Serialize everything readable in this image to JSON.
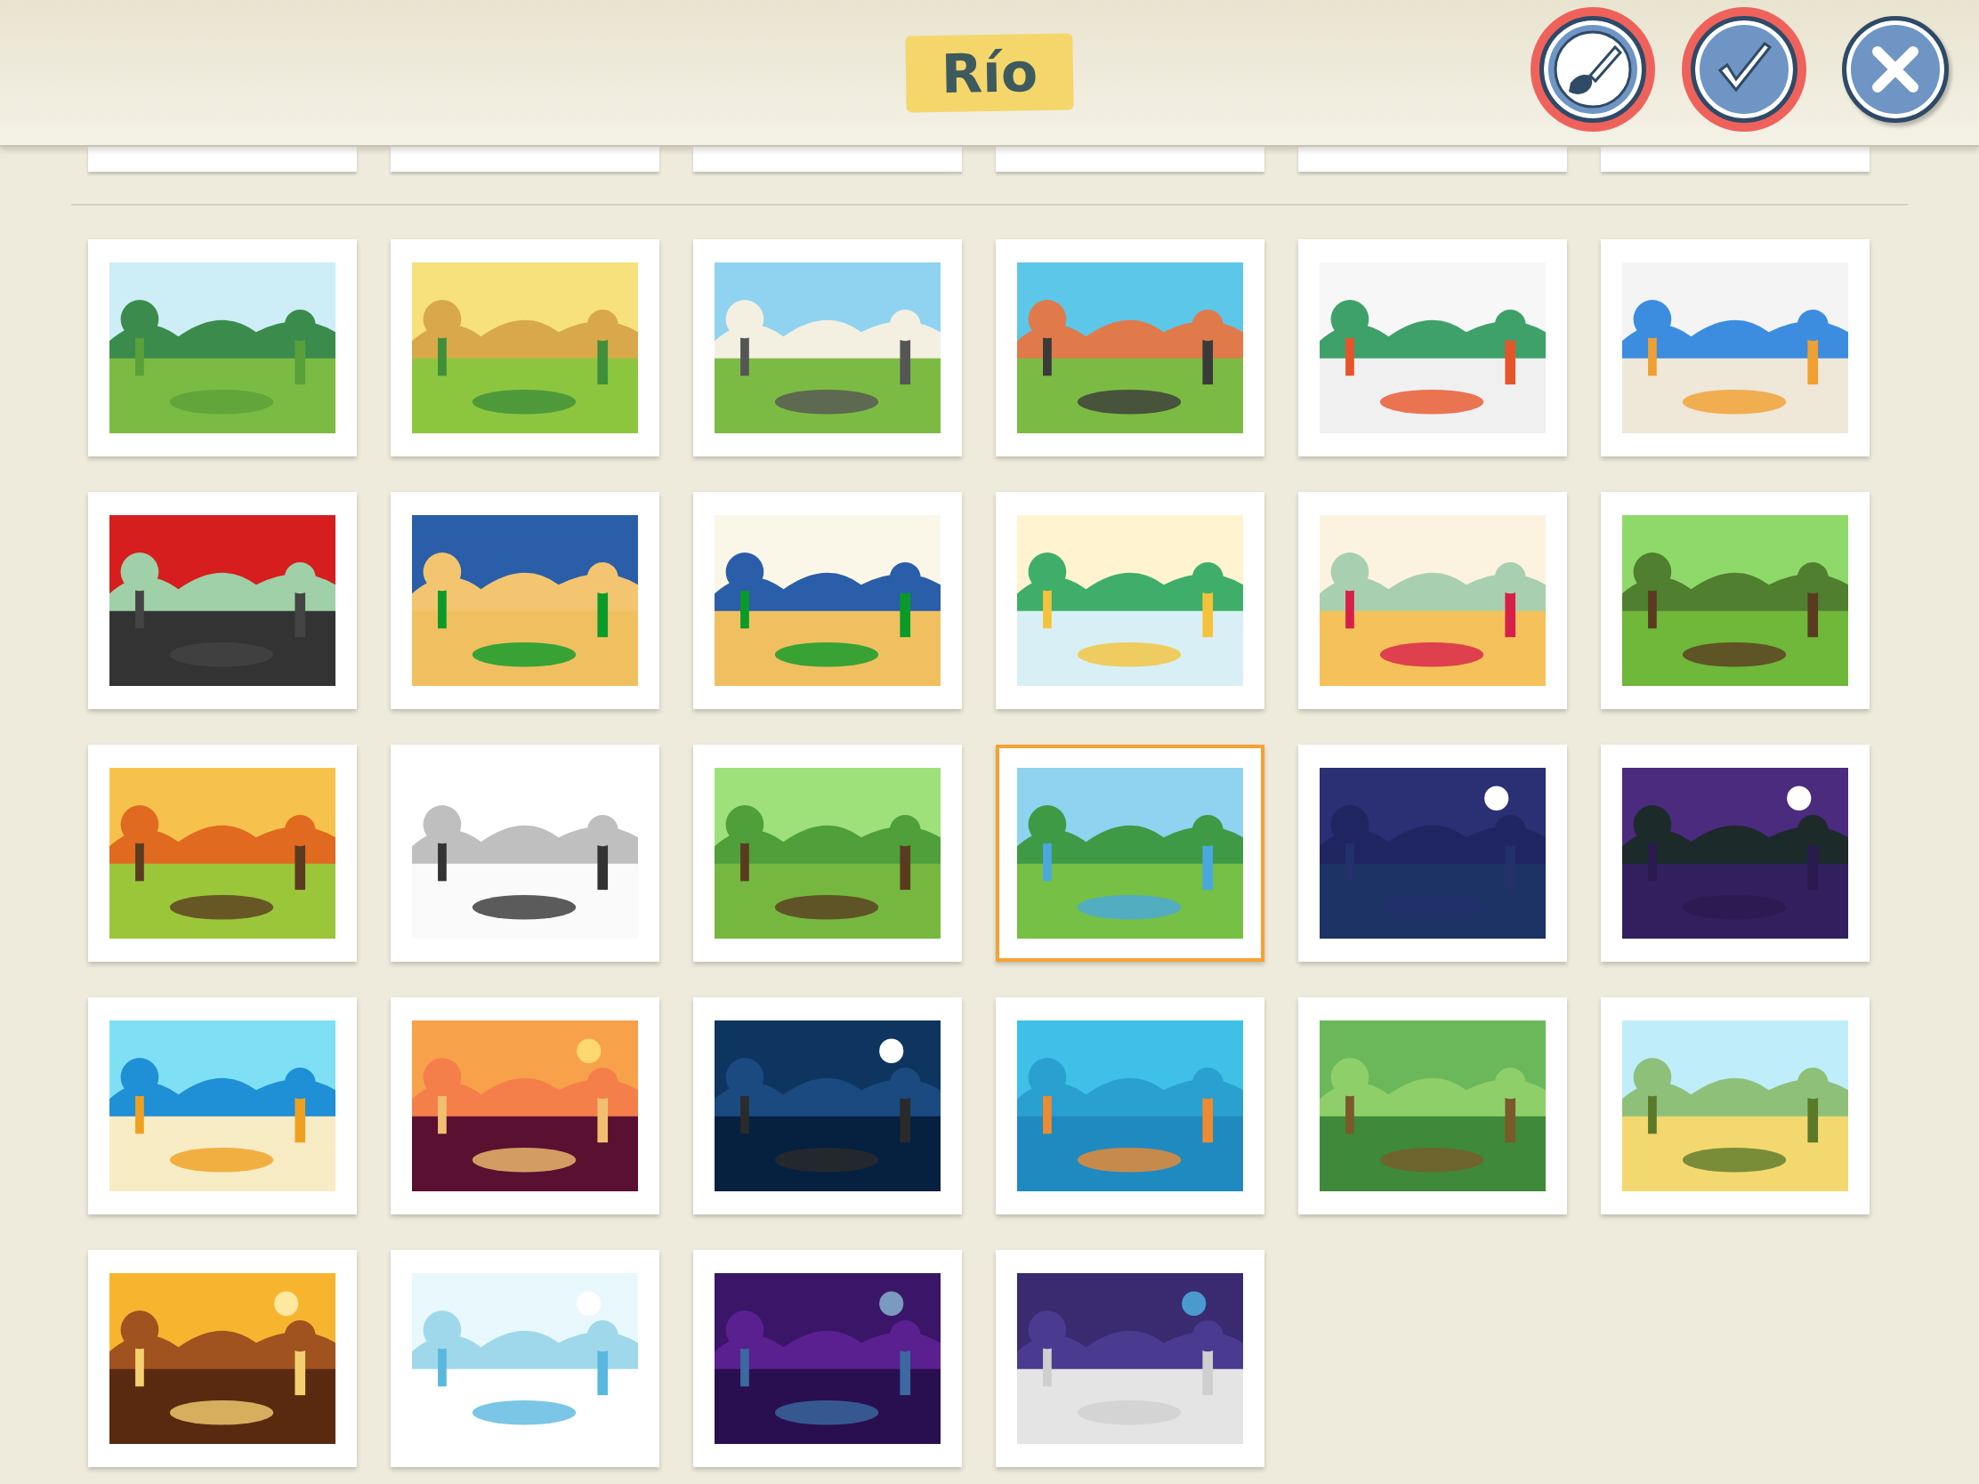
{
  "title": "Río",
  "buttons": [
    {
      "kind": "paint",
      "highlighted": true
    },
    {
      "kind": "accept",
      "highlighted": true
    },
    {
      "kind": "close",
      "highlighted": false
    }
  ],
  "backgrounds": [
    {
      "selected": false
    },
    {
      "selected": false
    },
    {
      "selected": false
    },
    {
      "selected": false
    },
    {
      "selected": false
    },
    {
      "selected": false
    },
    {
      "selected": false
    },
    {
      "selected": false
    },
    {
      "selected": false
    },
    {
      "selected": false
    },
    {
      "selected": false
    },
    {
      "selected": false
    },
    {
      "selected": false
    },
    {
      "selected": false
    },
    {
      "selected": false
    },
    {
      "selected": true
    },
    {
      "selected": false
    },
    {
      "selected": false
    },
    {
      "selected": false
    },
    {
      "selected": false
    },
    {
      "selected": false
    },
    {
      "selected": false
    },
    {
      "selected": false
    },
    {
      "selected": false
    },
    {
      "selected": false
    },
    {
      "selected": false
    },
    {
      "selected": false
    },
    {
      "selected": false
    }
  ]
}
